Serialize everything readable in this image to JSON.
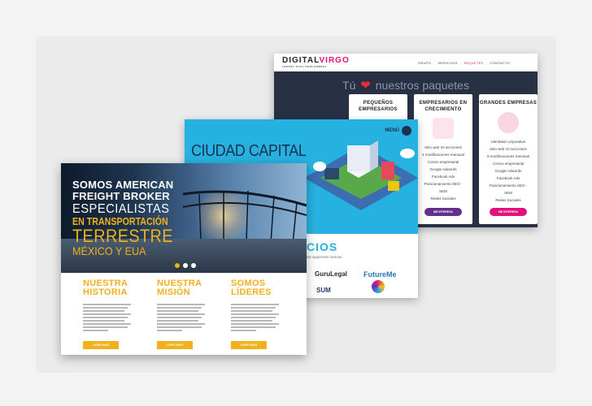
{
  "digital_virgo": {
    "logo": "DIGITAL",
    "logo_accent": "VIRGO",
    "logo_tagline": "[SMART DATA PERFORMER]",
    "nav": [
      "GRUPO",
      "SERVICIOS",
      "PAQUETES",
      "CONTACTO"
    ],
    "hero_before": "Tú",
    "hero_after": "nuestros paquetes",
    "packages": [
      {
        "title": "PEQUEÑOS EMPRESARIOS",
        "features": [],
        "button": ""
      },
      {
        "title": "EMPRESARIOS EN CRECIMIENTO",
        "features": [
          "Sitio web 10 secciones",
          "4 modificaciones mensual",
          "Correo empresarial",
          "Google Adwords",
          "Facebook Ads",
          "Posicionamiento SEO -",
          "SEM",
          "Redes Sociales"
        ],
        "button": "ME INTERESA"
      },
      {
        "title": "GRANDES EMPRESAS",
        "features": [
          "Identidad corporativa",
          "Sitio web 10 secciones",
          "8 modificaciones mensual",
          "Correo empresarial",
          "Google Adwords",
          "Facebook Ads",
          "Posicionamiento SEO -",
          "SEM",
          "Redes Sociales"
        ],
        "button": "ME INTERESA"
      }
    ],
    "accent_color": "#e3117b"
  },
  "ciudad_capital": {
    "title": "CIUDAD CAPITAL",
    "menu_label": "MENÚ",
    "section_title": "CIOS",
    "section_text": "las siguientes marcas:",
    "brands": [
      "GuruLegal",
      "FutureMe",
      "SUM"
    ]
  },
  "american_freight": {
    "hero": {
      "line1": "SOMOS AMERICAN",
      "line2": "FREIGHT BROKER",
      "line3": "ESPECIALISTAS",
      "line4": "EN TRANSPORTACIÓN",
      "line5": "TERRESTRE",
      "line6": "MÉXICO Y EUA"
    },
    "columns": [
      {
        "title_1": "NUESTRA",
        "title_2": "HISTORIA",
        "button": "LEER MÁS"
      },
      {
        "title_1": "NUESTRA",
        "title_2": "MISIÓN",
        "button": "LEER MÁS"
      },
      {
        "title_1": "SOMOS",
        "title_2": "LÍDERES",
        "button": "LEER MÁS"
      }
    ],
    "accent_color": "#f0b11b"
  }
}
